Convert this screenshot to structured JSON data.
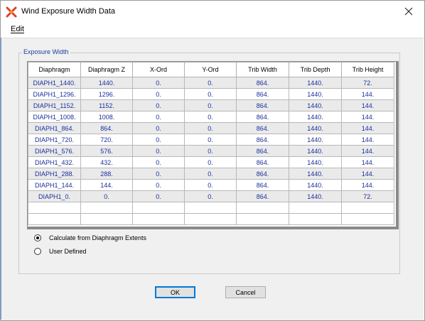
{
  "window": {
    "title": "Wind Exposure Width Data",
    "icons": {
      "app": "x-cross-app-icon",
      "close": "close-icon"
    }
  },
  "menu": {
    "edit": "Edit"
  },
  "group": {
    "label": "Exposure Width"
  },
  "table": {
    "headers": [
      "Diaphragm",
      "Diaphragm Z",
      "X-Ord",
      "Y-Ord",
      "Trib Width",
      "Trib Depth",
      "Trib Height"
    ],
    "rows": [
      [
        "DIAPH1_1440.",
        "1440.",
        "0.",
        "0.",
        "864.",
        "1440.",
        "72."
      ],
      [
        "DIAPH1_1296.",
        "1296.",
        "0.",
        "0.",
        "864.",
        "1440.",
        "144."
      ],
      [
        "DIAPH1_1152.",
        "1152.",
        "0.",
        "0.",
        "864.",
        "1440.",
        "144."
      ],
      [
        "DIAPH1_1008.",
        "1008.",
        "0.",
        "0.",
        "864.",
        "1440.",
        "144."
      ],
      [
        "DIAPH1_864.",
        "864.",
        "0.",
        "0.",
        "864.",
        "1440.",
        "144."
      ],
      [
        "DIAPH1_720.",
        "720.",
        "0.",
        "0.",
        "864.",
        "1440.",
        "144."
      ],
      [
        "DIAPH1_576.",
        "576.",
        "0.",
        "0.",
        "864.",
        "1440.",
        "144."
      ],
      [
        "DIAPH1_432.",
        "432.",
        "0.",
        "0.",
        "864.",
        "1440.",
        "144."
      ],
      [
        "DIAPH1_288.",
        "288.",
        "0.",
        "0.",
        "864.",
        "1440.",
        "144."
      ],
      [
        "DIAPH1_144.",
        "144.",
        "0.",
        "0.",
        "864.",
        "1440.",
        "144."
      ],
      [
        "DIAPH1_0.",
        "0.",
        "0.",
        "0.",
        "864.",
        "1440.",
        "72."
      ]
    ],
    "empty_rows": 2
  },
  "options": {
    "calc_label": "Calculate from Diaphragm Extents",
    "calc_selected": true,
    "user_label": "User Defined",
    "user_selected": false
  },
  "buttons": {
    "ok": "OK",
    "cancel": "Cancel"
  },
  "colors": {
    "cell_text": "#1b2f9a",
    "group_label": "#1a3e9b",
    "default_button_border": "#0078d7"
  }
}
